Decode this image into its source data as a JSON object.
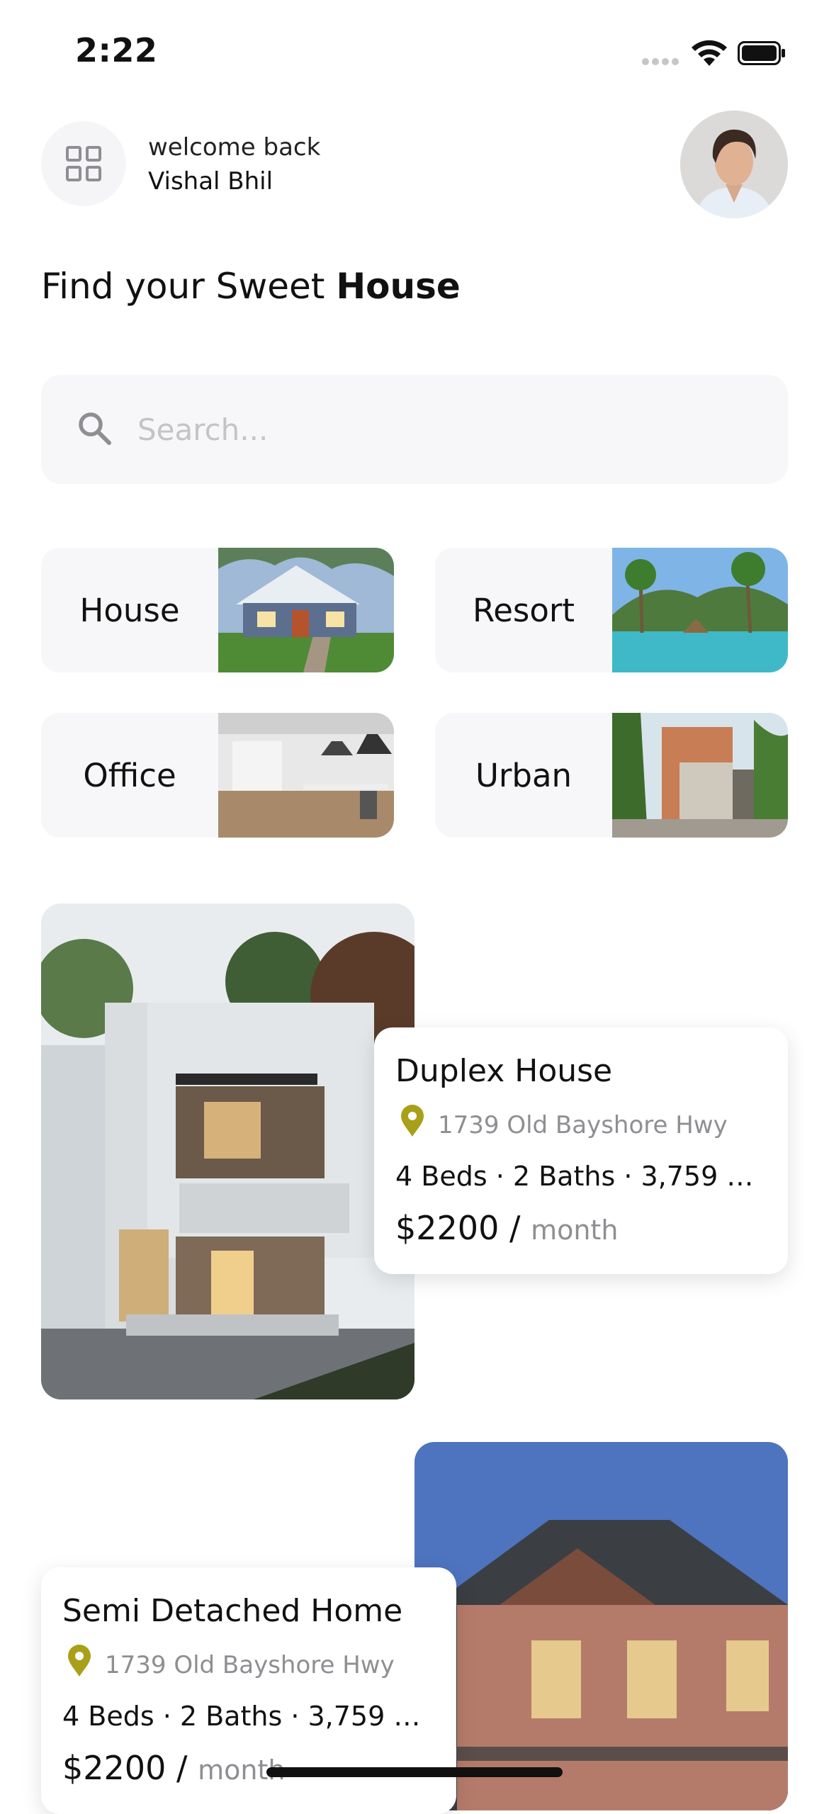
{
  "status_bar": {
    "time": "2:22"
  },
  "header": {
    "greeting": "welcome back",
    "user_name": "Vishal Bhil",
    "headline_prefix": "Find your Sweet ",
    "headline_bold": "House"
  },
  "search": {
    "placeholder": "Search..."
  },
  "categories": [
    {
      "label": "House"
    },
    {
      "label": "Resort"
    },
    {
      "label": "Office"
    },
    {
      "label": "Urban"
    }
  ],
  "listings": [
    {
      "title": "Duplex House",
      "address": "1739 Old Bayshore Hwy",
      "specs": "4 Beds · 2 Baths · 3,759 Ft...",
      "price": "$2200 /",
      "period": "month"
    },
    {
      "title": "Semi Detached Home",
      "address": "1739 Old Bayshore Hwy",
      "specs": "4 Beds · 2 Baths · 3,759 Ft...",
      "price": "$2200 /",
      "period": "month"
    }
  ],
  "colors": {
    "accent_pin": "#a8a018",
    "card_bg": "#f7f7f9",
    "muted_text": "#8e8e93"
  }
}
